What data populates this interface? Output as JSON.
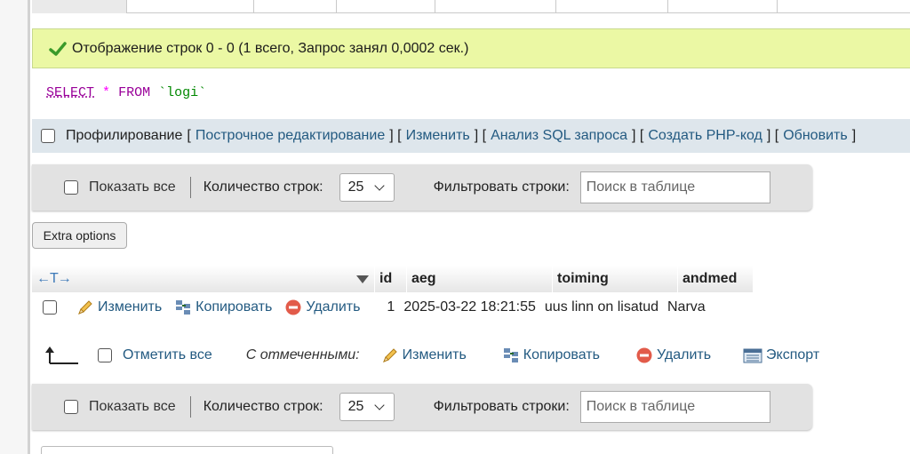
{
  "success_message": "Отображение строк 0 - 0 (1 всего, Запрос занял 0,0002 сек.)",
  "sql": {
    "select": "SELECT",
    "star": "*",
    "from": "FROM",
    "table": "`logi`"
  },
  "profiling": {
    "label": "Профилирование",
    "open": "[",
    "sep": "] [",
    "close": "]",
    "links": [
      "Построчное редактирование",
      "Изменить",
      "Анализ SQL запроса",
      "Создать PHP-код",
      "Обновить"
    ]
  },
  "nav": {
    "show_all": "Показать все",
    "rows_label": "Количество строк:",
    "rows_value": "25",
    "filter_label": "Фильтровать строки:",
    "search_placeholder": "Поиск в таблице"
  },
  "extra_options": "Extra options",
  "table": {
    "sort_arrows": "←T→",
    "columns": [
      "id",
      "aeg",
      "toiming",
      "andmed"
    ],
    "row_actions": {
      "edit": "Изменить",
      "copy": "Копировать",
      "delete": "Удалить"
    },
    "rows": [
      {
        "id": "1",
        "aeg": "2025-03-22 18:21:55",
        "toiming": "uus linn on lisatud",
        "andmed": "Narva"
      }
    ]
  },
  "bulk": {
    "check_all": "Отметить все",
    "with_selected": "С отмеченными:",
    "edit": "Изменить",
    "copy": "Копировать",
    "delete": "Удалить",
    "export": "Экспорт"
  },
  "colors": {
    "success_bg": "#ebf8a4",
    "link": "#235a81",
    "bar_bg": "#e2e2e2",
    "profiling_bg": "#dee6ec"
  }
}
